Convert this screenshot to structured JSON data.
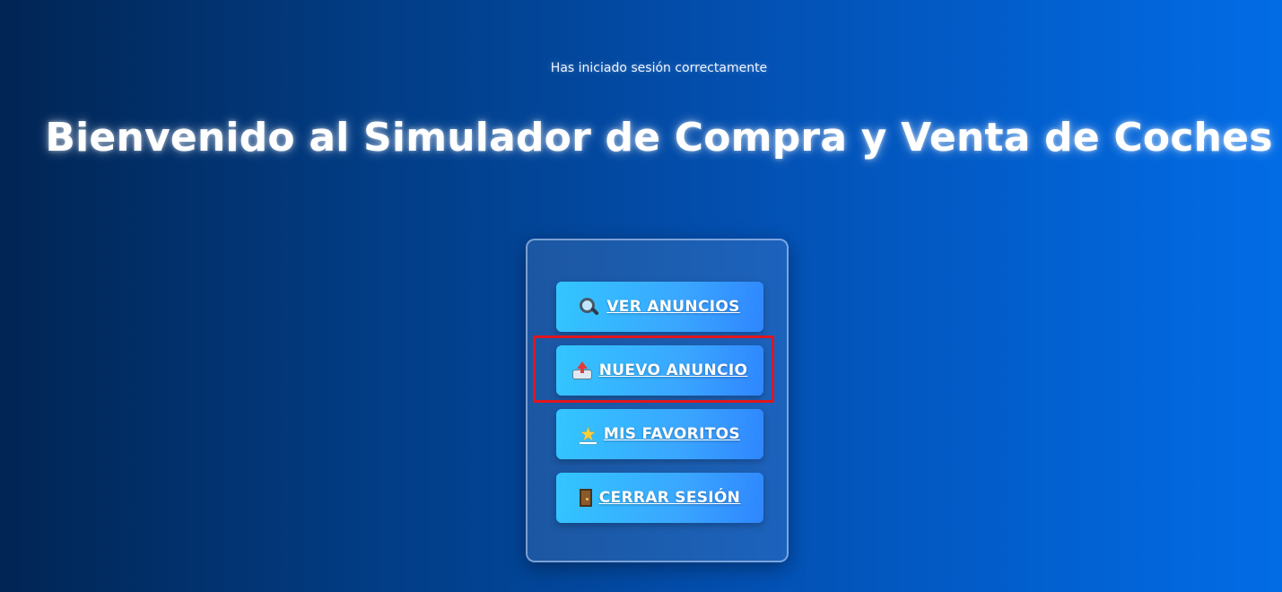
{
  "status_message": "Has iniciado sesión correctamente",
  "page_title": "Bienvenido al Simulador de Compra y Venta de Coches",
  "menu": {
    "items": [
      {
        "label": "VER ANUNCIOS",
        "icon": "magnifier-icon"
      },
      {
        "label": "NUEVO ANUNCIO",
        "icon": "upload-icon"
      },
      {
        "label": "MIS FAVORITOS",
        "icon": "star-icon"
      },
      {
        "label": "CERRAR SESIÓN",
        "icon": "door-icon"
      }
    ]
  },
  "colors": {
    "background_start": "#012554",
    "background_end": "#026ce6",
    "button_start": "#33c6ff",
    "button_end": "#2f86ff",
    "highlight": "#e0161e"
  }
}
